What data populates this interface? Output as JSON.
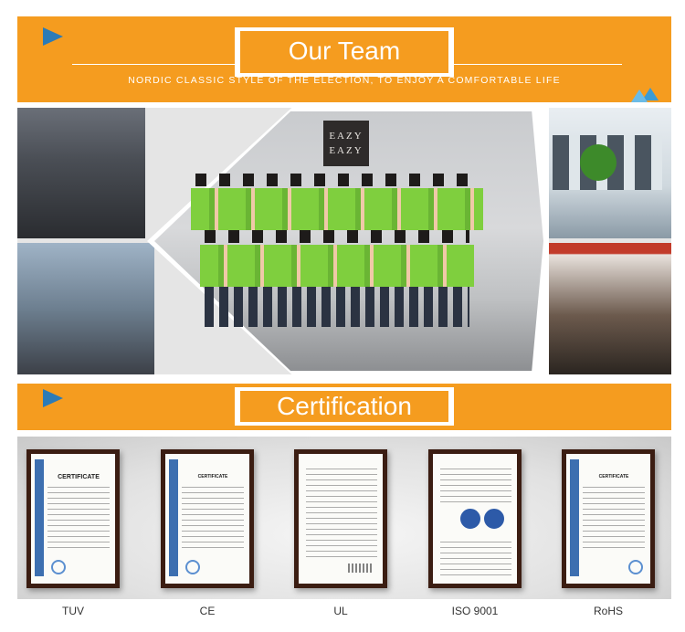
{
  "team_banner": {
    "title": "Our Team",
    "subtitle": "NORDIC CLASSIC STYLE OF THE ELECTION, TO ENJOY A COMFORTABLE LIFE"
  },
  "collage": {
    "logo_line1": "EAZY",
    "logo_line2": "EAZY"
  },
  "cert_banner": {
    "title": "Certification"
  },
  "certificates": [
    {
      "label": "TUV",
      "heading": "CERTIFICATE"
    },
    {
      "label": "CE",
      "heading": "CERTIFICATE"
    },
    {
      "label": "UL",
      "heading": ""
    },
    {
      "label": "ISO 9001",
      "heading": ""
    },
    {
      "label": "RoHS",
      "heading": "CERTIFICATE"
    }
  ],
  "colors": {
    "banner": "#f59c1f",
    "accent_blue": "#2c7bb6",
    "frame": "#3b1d12"
  }
}
